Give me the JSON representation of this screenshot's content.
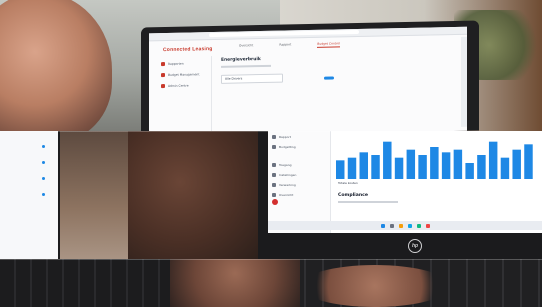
{
  "top_screen": {
    "brand": "Connected Leasing",
    "tabs": [
      "Overzicht",
      "Rapport",
      "Budget Control"
    ],
    "active_tab": 2,
    "sidebar_items": [
      "Rapporten",
      "Budget Management",
      "Admin Centre"
    ],
    "content_title": "Energieverbruik",
    "dropdown_value": "Alle Drivers"
  },
  "bottom_screen": {
    "nav_items": [
      "Rapport",
      "Budgetting",
      "Toegang",
      "Instellingen",
      "Verwerking",
      "Overzicht"
    ],
    "caption": "Totale kosten",
    "section_title": "Compliance"
  },
  "chart_data": {
    "type": "bar",
    "color": "#1e88e5",
    "values": [
      7,
      8,
      10,
      9,
      14,
      8,
      11,
      9,
      12,
      10,
      11,
      6,
      9,
      14,
      8,
      11,
      13
    ]
  }
}
